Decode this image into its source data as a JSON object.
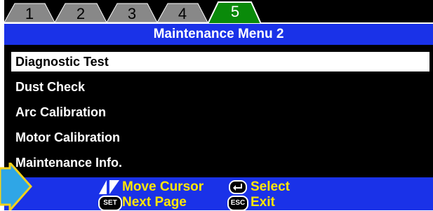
{
  "tabs": [
    {
      "label": "1",
      "active": false
    },
    {
      "label": "2",
      "active": false
    },
    {
      "label": "3",
      "active": false
    },
    {
      "label": "4",
      "active": false
    },
    {
      "label": "5",
      "active": true
    }
  ],
  "title": "Maintenance Menu 2",
  "menu": {
    "items": [
      {
        "label": "Diagnostic Test",
        "selected": true
      },
      {
        "label": "Dust Check",
        "selected": false
      },
      {
        "label": "Arc Calibration",
        "selected": false
      },
      {
        "label": "Motor Calibration",
        "selected": false
      },
      {
        "label": "Maintenance Info.",
        "selected": false
      }
    ]
  },
  "footer": {
    "move_cursor": {
      "icon": "up-down-arrows-icon",
      "label": "Move Cursor"
    },
    "select": {
      "icon": "enter-key-icon",
      "label": "Select"
    },
    "next_page": {
      "icon": "set-key-icon",
      "key": "SET",
      "label": "Next Page"
    },
    "exit": {
      "icon": "esc-key-icon",
      "key": "ESC",
      "label": "Exit"
    }
  },
  "colors": {
    "title_bar": "#1a32e8",
    "hint_text": "#ffe600",
    "tab_inactive": "#888888",
    "tab_active": "#0a8a0a",
    "pointer": "#2fa6e6"
  }
}
